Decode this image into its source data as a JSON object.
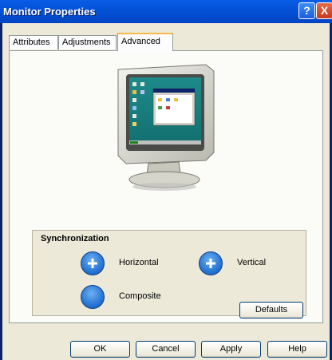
{
  "window": {
    "title": "Monitor Properties"
  },
  "title_buttons": {
    "help": "?",
    "close": "X"
  },
  "tabs": [
    {
      "label": "Attributes"
    },
    {
      "label": "Adjustments"
    },
    {
      "label": "Advanced"
    }
  ],
  "synchronization": {
    "title": "Synchronization",
    "options": [
      {
        "label": "Horizontal"
      },
      {
        "label": "Vertical"
      },
      {
        "label": "Composite"
      }
    ]
  },
  "buttons": {
    "defaults": "Defaults",
    "ok": "OK",
    "cancel": "Cancel",
    "apply": "Apply",
    "help": "Help"
  }
}
